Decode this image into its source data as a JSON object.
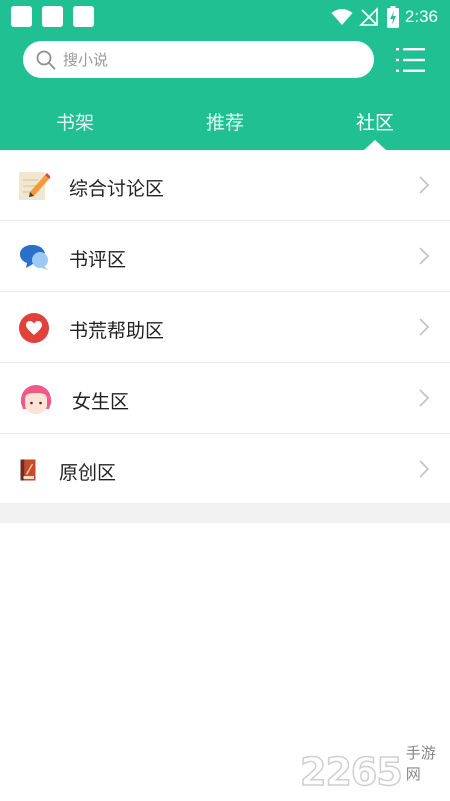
{
  "status_bar": {
    "time": "2:36",
    "icons": [
      "notification-square-icon",
      "wifi-icon",
      "no-signal-icon",
      "battery-charging-icon"
    ]
  },
  "search": {
    "placeholder": "搜小说"
  },
  "tabs": [
    {
      "label": "书架",
      "active": false
    },
    {
      "label": "推荐",
      "active": false
    },
    {
      "label": "社区",
      "active": true
    }
  ],
  "list": [
    {
      "label": "综合讨论区",
      "icon": "notepad-pencil-icon"
    },
    {
      "label": "书评区",
      "icon": "chat-bubbles-icon"
    },
    {
      "label": "书荒帮助区",
      "icon": "heart-icon"
    },
    {
      "label": "女生区",
      "icon": "girl-face-icon"
    },
    {
      "label": "原创区",
      "icon": "book-icon"
    }
  ],
  "watermark": {
    "number": "2265",
    "text": "手游网"
  },
  "colors": {
    "accent": "#21c093",
    "divider": "#ececec"
  }
}
